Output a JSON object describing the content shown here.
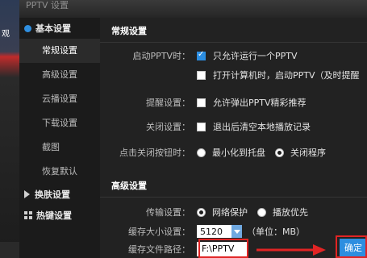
{
  "window": {
    "title": "PPTV 设置"
  },
  "left_strip": {
    "text": "观"
  },
  "sidebar": {
    "basic_category": "基本设置",
    "items": [
      "常规设置",
      "高级设置",
      "云播设置",
      "下载设置",
      "截图",
      "恢复默认"
    ],
    "skin_category": "换肤设置",
    "hotkey_category": "热键设置"
  },
  "general": {
    "title": "常规设置",
    "startup_label": "启动PPTV时：",
    "single_instance": "只允许运行一个PPTV",
    "autostart": "打开计算机时，启动PPTV（及时提醒",
    "reminder_label": "提醒设置：",
    "reminder_text": "允许弹出PPTV精彩推荐",
    "close_label": "关闭设置：",
    "close_text": "退出后清空本地播放记录",
    "close_btn_label": "点击关闭按钮时：",
    "minimize": "最小化到托盘",
    "exit": "关闭程序"
  },
  "advanced": {
    "title": "高级设置",
    "transfer_label": "传输设置：",
    "network_protect": "网络保护",
    "play_first": "播放优先",
    "cache_size_label": "缓存大小设置：",
    "cache_size": "5120",
    "cache_unit": "（单位：MB）",
    "cache_path_label": "缓存文件路径：",
    "cache_path": "F:\\PPTV"
  },
  "buttons": {
    "ok": "确定"
  },
  "state": {
    "single_instance": true,
    "autostart": false,
    "reminder": false,
    "clear_on_exit": false,
    "close_action": "关闭程序",
    "transfer_mode": "网络保护"
  },
  "colors": {
    "accent": "#2d8ee0",
    "annotation_red": "#e12424"
  },
  "icons": [
    "gear-icon",
    "skin-icon",
    "hotkey-icon",
    "dropdown-arrow-icon",
    "red-arrow-icon"
  ]
}
